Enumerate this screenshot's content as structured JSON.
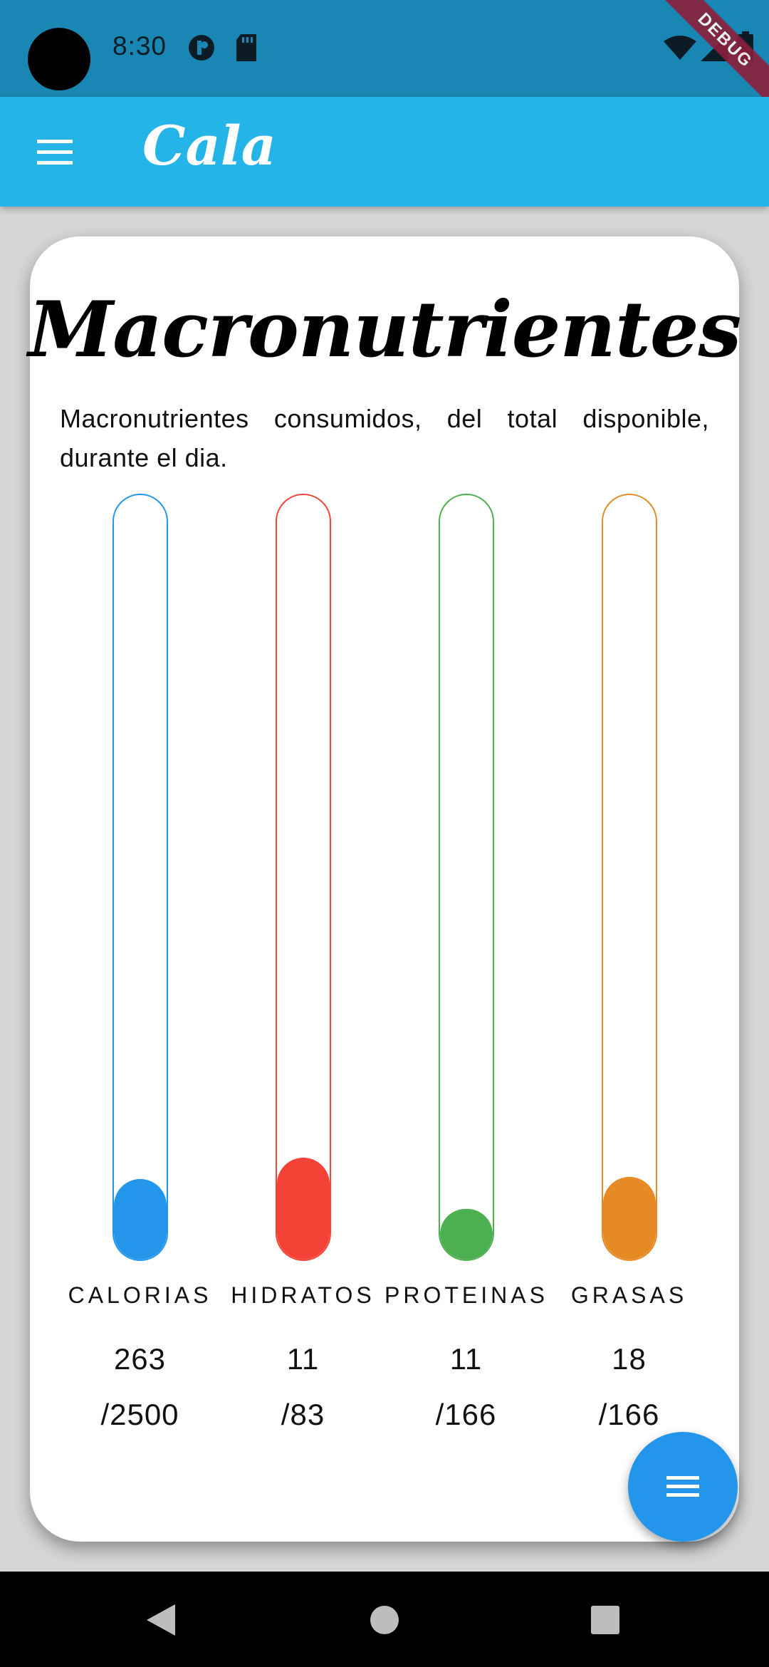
{
  "status_bar": {
    "time": "8:30",
    "debug_label": "DEBUG",
    "icons": [
      "notification-app-icon",
      "sd-card-icon",
      "wifi-icon",
      "signal-icon",
      "battery-icon"
    ]
  },
  "app_bar": {
    "title": "Cala",
    "menu_icon": "hamburger-menu-icon",
    "background": "#25b4e8"
  },
  "card": {
    "title": "Macronutrientes",
    "description": "Macronutrientes consumidos, del total disponible, durante el dia."
  },
  "macros": [
    {
      "label": "CALORIAS",
      "value": "263",
      "total": "/2500",
      "color": "#2396ec",
      "fill_fraction": 0.105
    },
    {
      "label": "HIDRATOS",
      "value": "11",
      "total": "/83",
      "color": "#f44336",
      "fill_fraction": 0.133
    },
    {
      "label": "PROTEINAS",
      "value": "11",
      "total": "/166",
      "color": "#4caf50",
      "fill_fraction": 0.066
    },
    {
      "label": "GRASAS",
      "value": "18",
      "total": "/166",
      "color": "#e68a26",
      "fill_fraction": 0.108
    }
  ],
  "fab": {
    "icon": "menu-icon",
    "color": "#2396ec"
  },
  "nav_bar": {
    "icons": [
      "back-icon",
      "home-icon",
      "recents-icon"
    ]
  }
}
